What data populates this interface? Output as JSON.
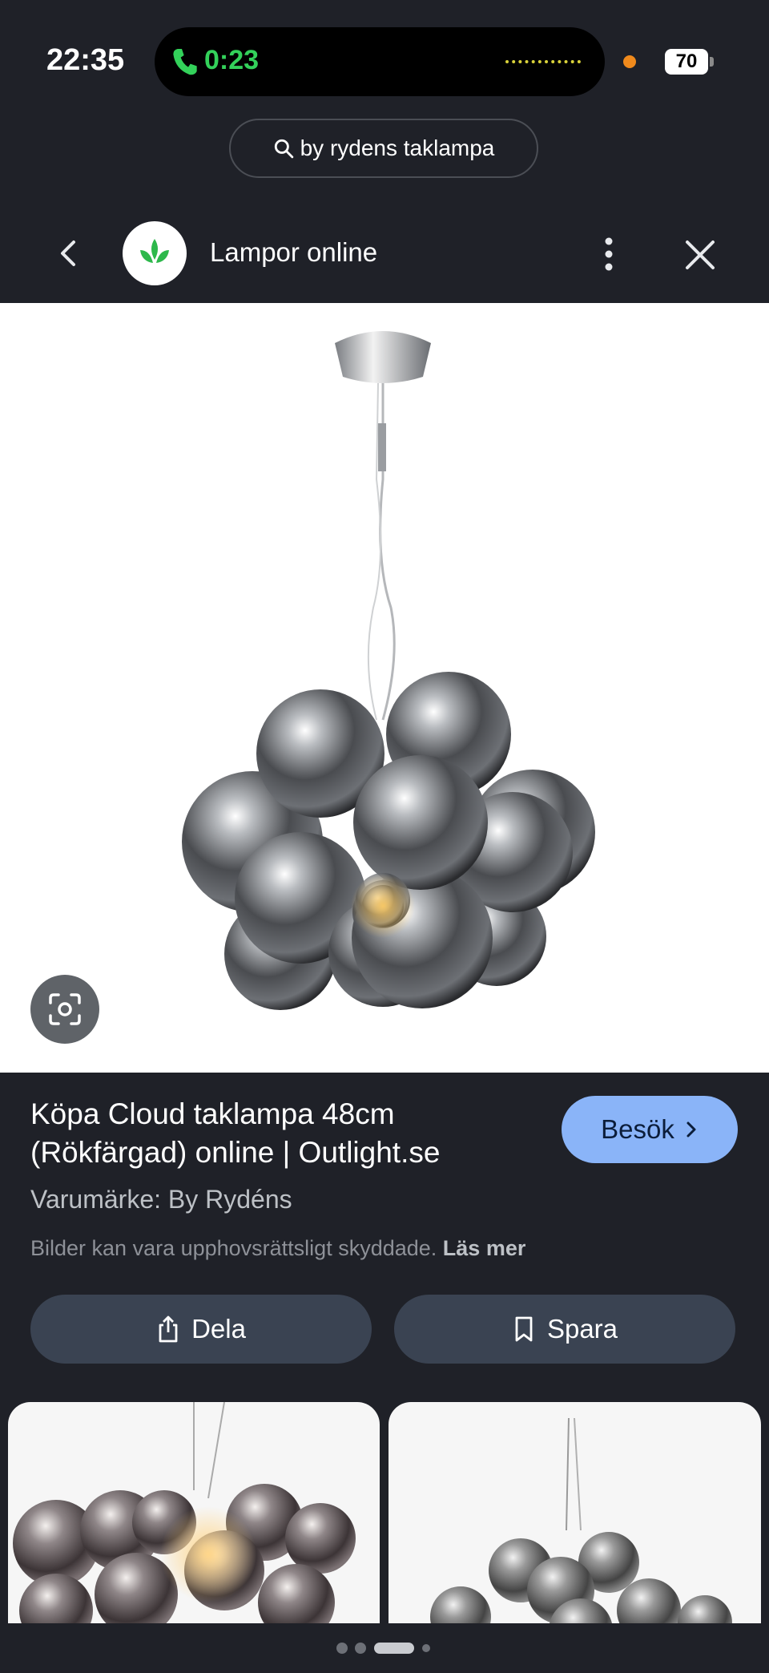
{
  "status_bar": {
    "time": "22:35",
    "call_duration": "0:23",
    "battery": "70"
  },
  "search": {
    "query": "by rydens taklampa"
  },
  "header": {
    "site_name": "Lampor online"
  },
  "result": {
    "title": "Köpa Cloud taklampa 48cm (Rökfärgad) online | Outlight.se",
    "visit_label": "Besök",
    "brand": "Varumärke: By Rydéns",
    "copyright_text": "Bilder kan vara upphovsrättsligt skyddade.",
    "read_more": "Läs mer"
  },
  "actions": {
    "share_label": "Dela",
    "save_label": "Spara"
  },
  "colors": {
    "background": "#1f2128",
    "accent": "#8ab4f8",
    "button": "#3a4352",
    "call_green": "#33d15a"
  },
  "pagination": {
    "pages": 4,
    "current": 3
  }
}
